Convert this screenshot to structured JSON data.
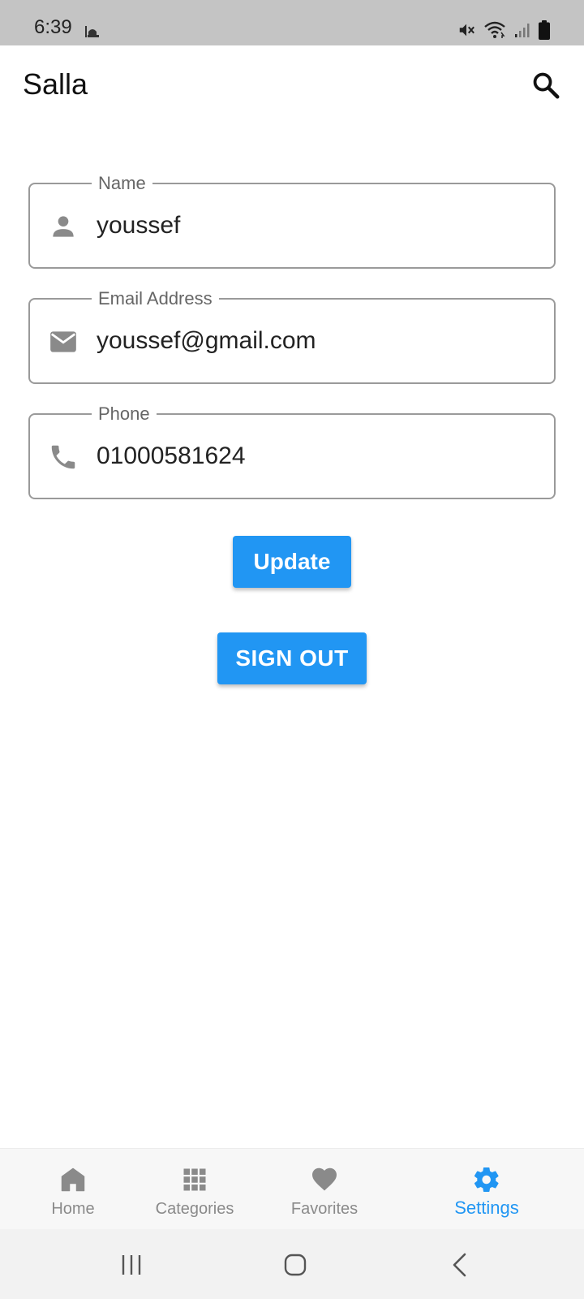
{
  "status_bar": {
    "time": "6:39",
    "icons": [
      "mosque-icon",
      "mute-icon",
      "wifi-icon",
      "signal-icon",
      "battery-icon"
    ]
  },
  "app_bar": {
    "title": "Salla",
    "search_icon": "search-icon"
  },
  "form": {
    "name": {
      "label": "Name",
      "value": "youssef",
      "icon": "person-icon"
    },
    "email": {
      "label": "Email Address",
      "value": "youssef@gmail.com",
      "icon": "email-icon"
    },
    "phone": {
      "label": "Phone",
      "value": "01000581624",
      "icon": "phone-icon"
    }
  },
  "buttons": {
    "update": "Update",
    "sign_out": "SIGN OUT"
  },
  "bottom_nav": {
    "items": [
      {
        "label": "Home",
        "icon": "home-icon",
        "active": false
      },
      {
        "label": "Categories",
        "icon": "grid-icon",
        "active": false
      },
      {
        "label": "Favorites",
        "icon": "heart-icon",
        "active": false
      },
      {
        "label": "Settings",
        "icon": "gear-icon",
        "active": true
      }
    ]
  },
  "colors": {
    "accent": "#2196f3",
    "inactive": "#8a8a8a",
    "status_bar_bg": "#c4c4c4"
  }
}
